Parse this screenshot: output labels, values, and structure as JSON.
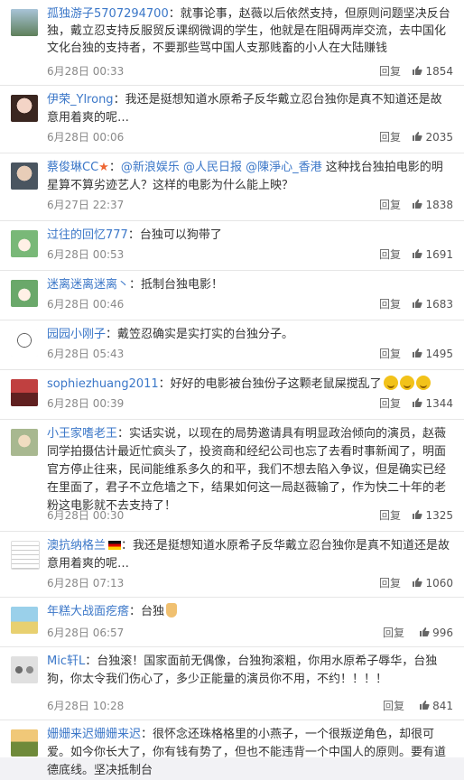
{
  "comments": [
    {
      "name": "孤独游子5707294700",
      "text": "：就事论事，赵薇以后依然支持，但原则问题坚决反台独，戴立忍支持反服贸反课纲微调的学生，他就是在阻碍两岸交流，去中国化文化台独的支持者，不要那些骂中国人支那贱畜的小人在大陆赚钱",
      "time": "6月28日 00:33",
      "reply": "回复",
      "likes": "1854"
    },
    {
      "name": "伊荣_Ylrong",
      "text": "：我还是挺想知道水原希子反华戴立忍台独你是真不知道还是故意用着爽的呢…",
      "time": "6月28日 00:06",
      "reply": "回复",
      "likes": "2035"
    },
    {
      "name": "蔡俊琳CC",
      "mentions": [
        "@新浪娱乐",
        "@人民日报",
        "@陳淨心_香港"
      ],
      "text": " 这种找台独拍电影的明星算不算劣迹艺人？这样的电影为什么能上映？",
      "time": "6月27日 22:37",
      "reply": "回复",
      "likes": "1838"
    },
    {
      "name": "过往的回忆777",
      "text": "：台独可以狗带了",
      "time": "6月28日 00:53",
      "reply": "回复",
      "likes": "1691"
    },
    {
      "name": "迷离迷离迷离丶",
      "text": "：抵制台独电影！",
      "time": "6月28日 00:46",
      "reply": "回复",
      "likes": "1683"
    },
    {
      "name": "园园小刚子",
      "text": "：戴笠忍确实是实打实的台独分子。",
      "time": "6月28日 05:43",
      "reply": "回复",
      "likes": "1495"
    },
    {
      "name": "sophiezhuang2011",
      "text": "：好好的电影被台独份子这颗老鼠屎搅乱了",
      "time": "6月28日 00:39",
      "reply": "回复",
      "likes": "1344"
    },
    {
      "name": "小王家嗜老王",
      "text": "：实话实说，以现在的局势邀请具有明显政治倾向的演员，赵薇同学拍摄估计最近忙疯头了，投资商和经纪公司也忘了去看时事新闻了，明面官方停止往来，民间能维系多久的和平，我们不想去陷入争议，但是确实已经在里面了，君子不立危墙之下，结果如何这一局赵薇输了，作为快二十年的老粉这电影就不去支持了！",
      "time": "6月28日 00:30",
      "reply": "回复",
      "likes": "1325"
    },
    {
      "name": "澳抗纳格兰",
      "text": "：我还是挺想知道水原希子反华戴立忍台独你是真不知道还是故意用着爽的呢…",
      "time": "6月28日 07:13",
      "reply": "回复",
      "likes": "1060"
    },
    {
      "name": "年糕大战面疙瘩",
      "text": "：台独",
      "time": "6月28日 06:57",
      "reply": "回复",
      "likes": "996"
    },
    {
      "name": "Mic轩L",
      "text": "：台独滚！国家面前无偶像，台独狗滚粗，你用水原希子辱华，台独狗，你太令我们伤心了，多少正能量的演员你不用，不约！！！！",
      "time": "6月28日 10:28",
      "reply": "回复",
      "likes": "841"
    },
    {
      "name": "姗姗来迟姗姗来迟",
      "text": "：很怀念还珠格格里的小燕子，一个很叛逆角色，却很可爱。如今你长大了，你有钱有势了，但也不能违背一个中国人的原则。要有道德底线。坚决抵制台",
      "time": "",
      "reply": "",
      "likes": ""
    }
  ],
  "avatar_icons": [
    "landscape",
    "woman-portrait",
    "man-portrait",
    "girl-anime",
    "girl-anime",
    "sketch-boy",
    "crowd-red",
    "old-man",
    "text-card",
    "cartoon-sea",
    "people",
    "sunset-field"
  ],
  "colors": {
    "link": "#3b77c8",
    "text": "#333333",
    "meta": "#888888",
    "divider": "#e6e6e6"
  }
}
